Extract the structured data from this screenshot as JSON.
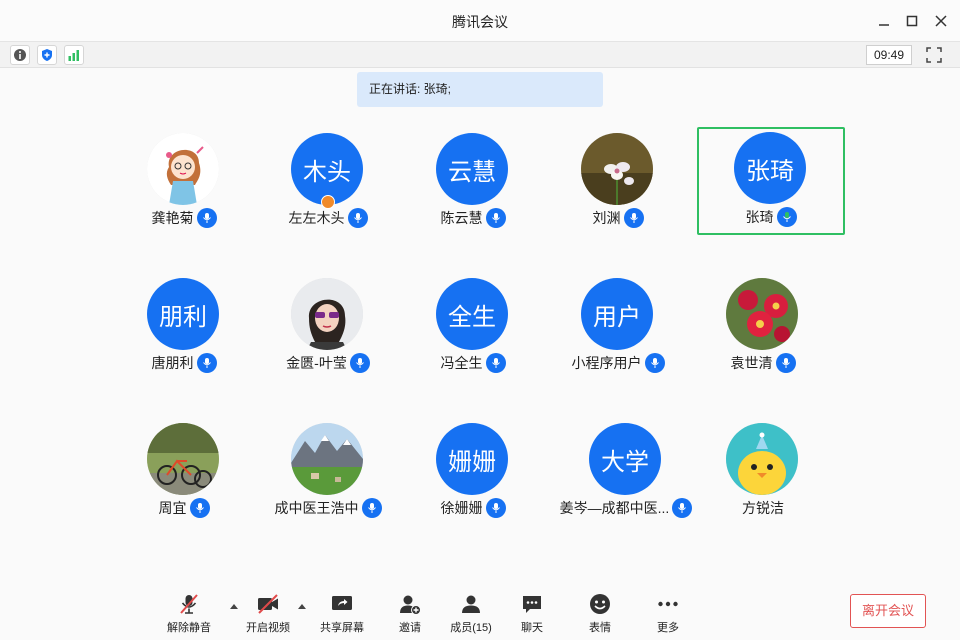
{
  "window": {
    "title": "腾讯会议"
  },
  "status": {
    "time": "09:49"
  },
  "speaking": {
    "text": "正在讲话: 张琦;"
  },
  "participants": [
    {
      "name": "龚艳菊",
      "avatar_text": "",
      "mic": "on"
    },
    {
      "name": "左左木头",
      "avatar_text": "木头",
      "mic": "on",
      "host": true
    },
    {
      "name": "陈云慧",
      "avatar_text": "云慧",
      "mic": "on"
    },
    {
      "name": "刘渊",
      "avatar_text": "",
      "mic": "on"
    },
    {
      "name": "张琦",
      "avatar_text": "张琦",
      "mic": "speaking",
      "active": true
    },
    {
      "name": "唐朋利",
      "avatar_text": "朋利",
      "mic": "on"
    },
    {
      "name": "金匮-叶莹",
      "avatar_text": "",
      "mic": "on"
    },
    {
      "name": "冯全生",
      "avatar_text": "全生",
      "mic": "on"
    },
    {
      "name": "小程序用户",
      "avatar_text": "用户",
      "mic": "on"
    },
    {
      "name": "袁世清",
      "avatar_text": "",
      "mic": "on"
    },
    {
      "name": "周宜",
      "avatar_text": "",
      "mic": "on"
    },
    {
      "name": "成中医王浩中",
      "avatar_text": "",
      "mic": "on"
    },
    {
      "name": "徐姗姗",
      "avatar_text": "姗姗",
      "mic": "on"
    },
    {
      "name": "姜岑—成都中医...",
      "avatar_text": "大学",
      "mic": "on"
    },
    {
      "name": "方锐洁",
      "avatar_text": "",
      "mic": "none"
    }
  ],
  "toolbar": {
    "unmute": "解除静音",
    "video": "开启视频",
    "share": "共享屏幕",
    "invite": "邀请",
    "members": "成员(15)",
    "chat": "聊天",
    "emoji": "表情",
    "more": "更多",
    "leave": "离开会议"
  },
  "colors": {
    "accent": "#1671f2",
    "speaking_mic": "#2fbf62",
    "active_border": "#2fbf62",
    "leave": "#e25454",
    "host_badge": "#f08a2a"
  }
}
